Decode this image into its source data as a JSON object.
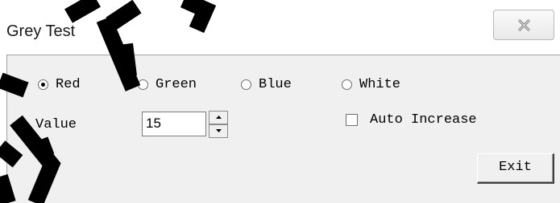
{
  "window": {
    "title": "Grey Test",
    "close_icon": "close-x-icon"
  },
  "colors": {
    "window_bg": "#ffffff",
    "client_bg": "#f0f0f0",
    "watermark": "#000000"
  },
  "color_options": {
    "selected": "Red",
    "items": [
      {
        "label": "Red",
        "checked": true
      },
      {
        "label": "Green",
        "checked": false
      },
      {
        "label": "Blue",
        "checked": false
      },
      {
        "label": "White",
        "checked": false
      }
    ]
  },
  "value": {
    "label": "Value",
    "current": "15",
    "spinner_up_icon": "spinner-up-arrow-icon",
    "spinner_down_icon": "spinner-down-arrow-icon"
  },
  "auto_increase": {
    "label": "Auto Increase",
    "checked": false
  },
  "exit_button": {
    "label": "Exit"
  }
}
